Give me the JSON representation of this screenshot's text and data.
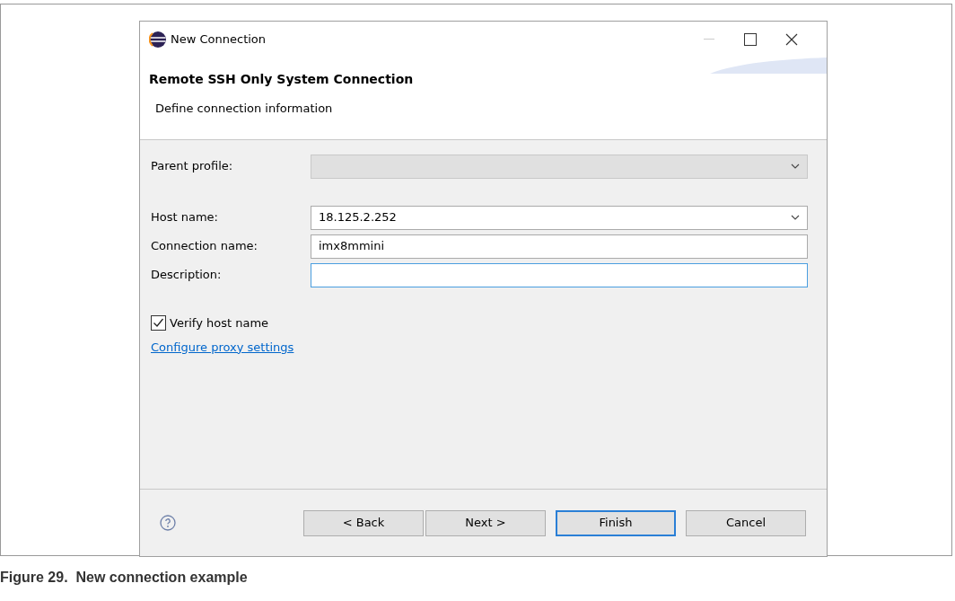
{
  "window": {
    "title": "New Connection"
  },
  "header": {
    "title": "Remote SSH Only System Connection",
    "subtitle": "Define connection information"
  },
  "fields": [
    {
      "label": "Parent profile:",
      "kind": "combo",
      "disabled": true,
      "focused": false
    },
    {
      "label": "Host name:",
      "kind": "combo",
      "value": "18.125.2.252",
      "disabled": false,
      "focused": false
    },
    {
      "label": "Connection name:",
      "kind": "text",
      "value": "imx8mmini",
      "disabled": false,
      "focused": false
    },
    {
      "label": "Description:",
      "kind": "text",
      "disabled": false,
      "focused": true
    }
  ],
  "verify_host": {
    "label": "Verify host name",
    "checked": true
  },
  "proxy_link": "Configure proxy settings",
  "buttons": [
    {
      "label": "< Back",
      "default": false
    },
    {
      "label": "Next >",
      "default": false
    },
    {
      "label": "Finish",
      "default": true
    },
    {
      "label": "Cancel",
      "default": false
    }
  ],
  "caption": "Figure 29.  New connection example"
}
